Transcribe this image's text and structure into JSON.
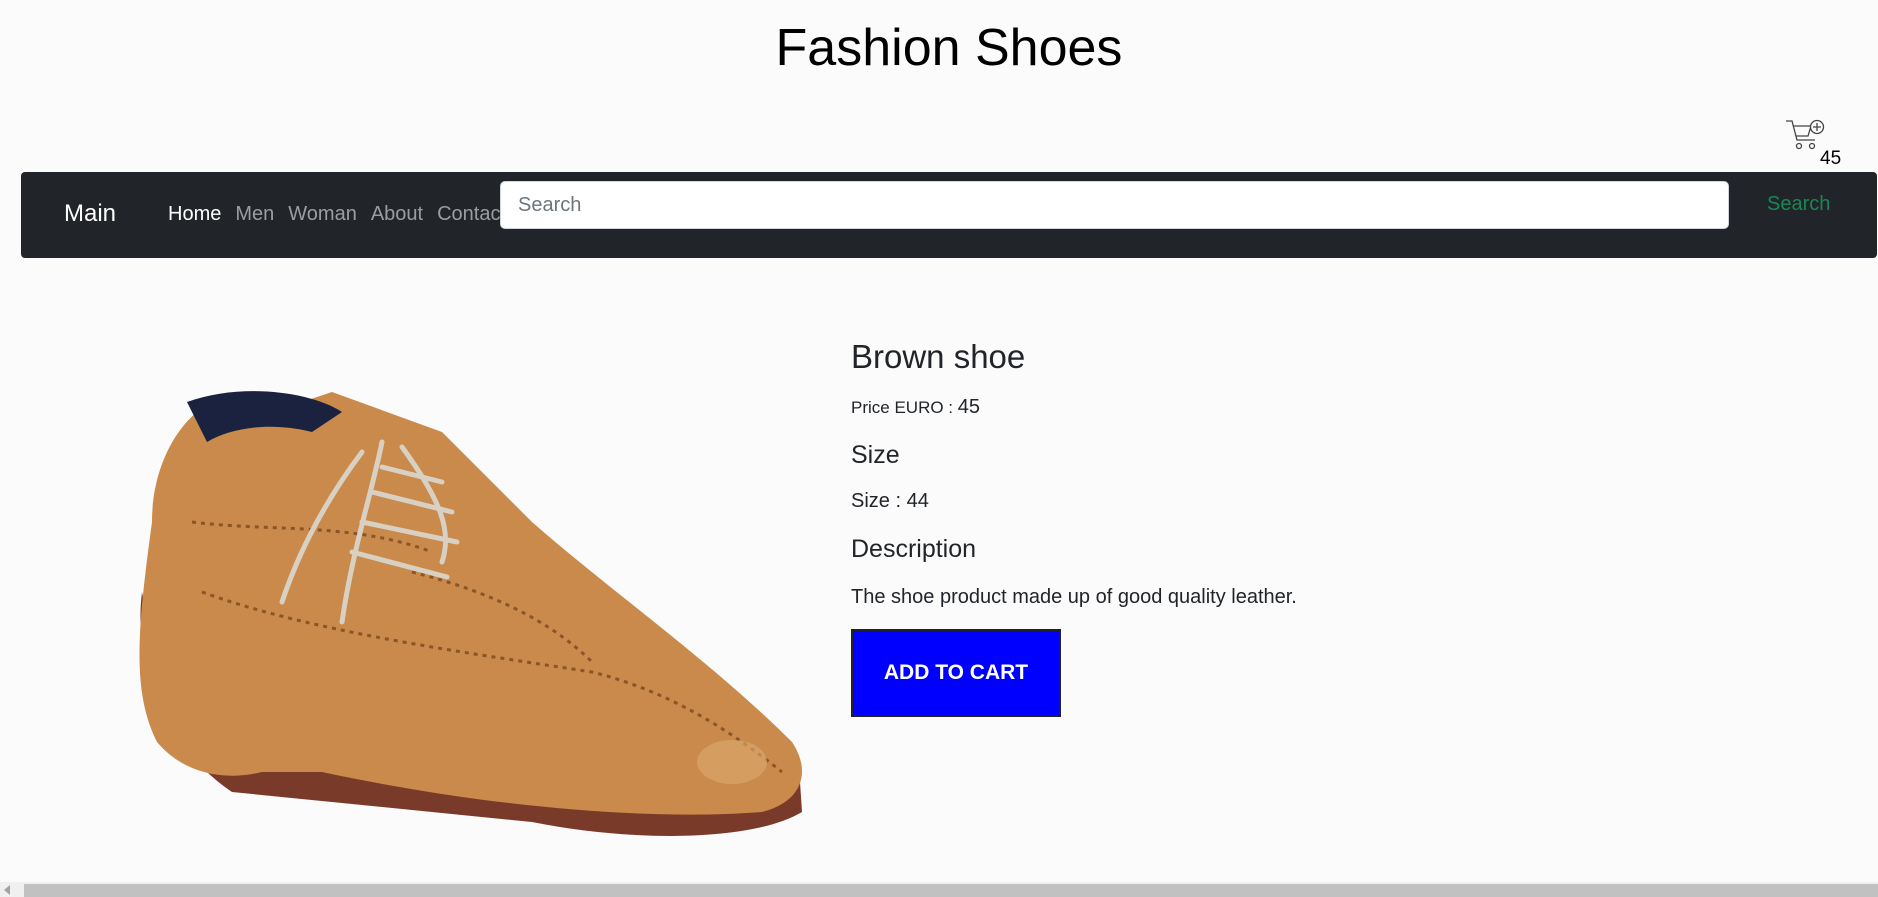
{
  "header": {
    "title": "Fashion Shoes"
  },
  "cart": {
    "count": "45",
    "icon": "cart-plus-icon"
  },
  "navbar": {
    "brand": "Main",
    "links": [
      {
        "label": "Home",
        "active": true
      },
      {
        "label": "Men",
        "active": false
      },
      {
        "label": "Woman",
        "active": false
      },
      {
        "label": "About",
        "active": false
      },
      {
        "label": "Contact",
        "active": false
      }
    ],
    "search": {
      "placeholder": "Search",
      "value": "",
      "button_label": "Search"
    }
  },
  "product": {
    "name": "Brown shoe",
    "price_label": "Price EURO : ",
    "price_value": "45",
    "size_heading": "Size",
    "size_text": "Size : 44",
    "description_heading": "Description",
    "description": "The shoe product made up of good quality leather.",
    "add_to_cart_label": "ADD TO CART"
  },
  "colors": {
    "navbar_bg": "#212529",
    "add_to_cart_bg": "#0000ff",
    "search_button": "#198754"
  }
}
